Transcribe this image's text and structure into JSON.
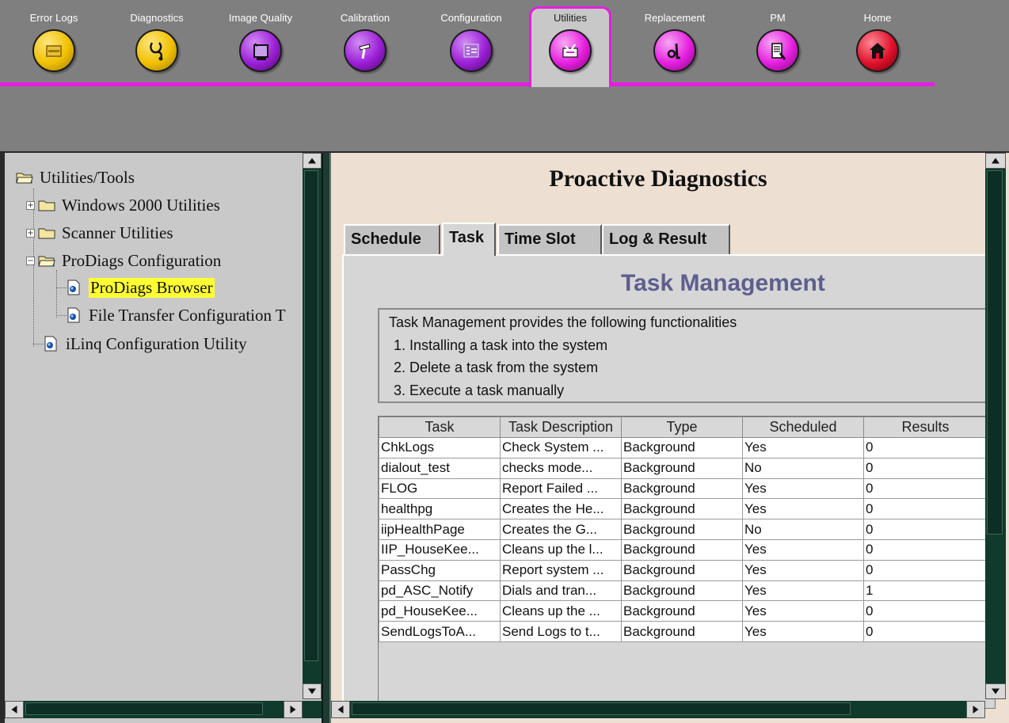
{
  "nav": {
    "items": [
      {
        "label": "Error Logs",
        "icon": "error-logs-icon",
        "color": "#f0c000"
      },
      {
        "label": "Diagnostics",
        "icon": "stethoscope-icon",
        "color": "#f0c000"
      },
      {
        "label": "Image Quality",
        "icon": "image-quality-icon",
        "color": "#9b1fd6"
      },
      {
        "label": "Calibration",
        "icon": "calibration-icon",
        "color": "#9b1fd6"
      },
      {
        "label": "Configuration",
        "icon": "configuration-icon",
        "color": "#9b1fd6"
      },
      {
        "label": "Utilities",
        "icon": "utilities-icon",
        "color": "#e61ee0"
      },
      {
        "label": "Replacement",
        "icon": "replacement-icon",
        "color": "#e61ee0"
      },
      {
        "label": "PM",
        "icon": "pm-icon",
        "color": "#e61ee0"
      },
      {
        "label": "Home",
        "icon": "home-icon",
        "color": "#e0102a"
      }
    ],
    "active": "Utilities"
  },
  "tree": {
    "root": "Utilities/Tools",
    "items": [
      {
        "label": "Windows 2000 Utilities"
      },
      {
        "label": "Scanner Utilities"
      },
      {
        "label": "ProDiags Configuration"
      },
      {
        "label": "ProDiags Browser"
      },
      {
        "label": "File Transfer Configuration T"
      },
      {
        "label": "iLinq Configuration Utility"
      }
    ]
  },
  "page": {
    "title": "Proactive Diagnostics",
    "tabs": [
      "Schedule",
      "Task",
      "Time Slot",
      "Log & Result"
    ],
    "active_tab": "Task"
  },
  "task_management": {
    "title": "Task Management",
    "intro": "Task Management provides the following functionalities",
    "points": [
      "1. Installing a task into the system",
      "2. Delete a task from the system",
      "3. Execute a task manually"
    ]
  },
  "table": {
    "headers": [
      "Task",
      "Task Description",
      "Type",
      "Scheduled",
      "Results"
    ],
    "rows": [
      [
        "ChkLogs",
        "Check System ...",
        "Background",
        "Yes",
        "0"
      ],
      [
        "dialout_test",
        "checks mode...",
        "Background",
        "No",
        "0"
      ],
      [
        "FLOG",
        "Report Failed ...",
        "Background",
        "Yes",
        "0"
      ],
      [
        "healthpg",
        "Creates the He...",
        "Background",
        "Yes",
        "0"
      ],
      [
        "iipHealthPage",
        "Creates the G...",
        "Background",
        "No",
        "0"
      ],
      [
        "IIP_HouseKee...",
        "Cleans up the l...",
        "Background",
        "Yes",
        "0"
      ],
      [
        "PassChg",
        "Report system ...",
        "Background",
        "Yes",
        "0"
      ],
      [
        "pd_ASC_Notify",
        "Dials and tran...",
        "Background",
        "Yes",
        "1"
      ],
      [
        "pd_HouseKee...",
        "Cleans up the ...",
        "Background",
        "Yes",
        "0"
      ],
      [
        "SendLogsToA...",
        "Send Logs to t...",
        "Background",
        "Yes",
        "0"
      ]
    ]
  },
  "colors": {
    "accent": "#e61ee0",
    "panel": "#c9c9c9",
    "content_bg": "#ede0d2",
    "heading": "#5e5e8e",
    "selection": "#ffff33",
    "scrollbar": "#0f3a2c"
  }
}
